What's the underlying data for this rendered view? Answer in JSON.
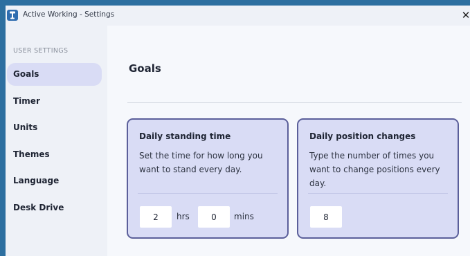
{
  "window": {
    "title": "Active Working - Settings",
    "close_label": "✕"
  },
  "sidebar": {
    "section_label": "USER SETTINGS",
    "items": [
      {
        "label": "Goals",
        "active": true
      },
      {
        "label": "Timer",
        "active": false
      },
      {
        "label": "Units",
        "active": false
      },
      {
        "label": "Themes",
        "active": false
      },
      {
        "label": "Language",
        "active": false
      },
      {
        "label": "Desk Drive",
        "active": false
      }
    ]
  },
  "main": {
    "title": "Goals",
    "cards": [
      {
        "title": "Daily standing time",
        "description": "Set the time for how long you want to stand every day.",
        "hours_value": "2",
        "hours_unit": "hrs",
        "minutes_value": "0",
        "minutes_unit": "mins"
      },
      {
        "title": "Daily position changes",
        "description": "Type the number of times you want to change positions every day.",
        "value": "8"
      }
    ]
  },
  "colors": {
    "desktop": "#2d6fa0",
    "sidebar_bg": "#eef1f7",
    "active_item": "#d9dcf5",
    "card_bg": "#d9dcf5",
    "card_border": "#5b5f9a",
    "app_icon": "#2f6db0"
  },
  "icons": {
    "app": "standing-desk-app-icon",
    "close": "close-icon"
  }
}
